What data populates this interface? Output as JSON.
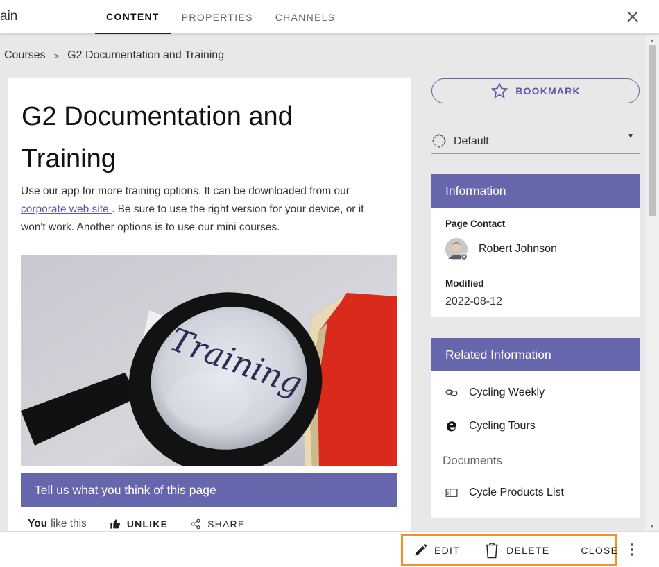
{
  "header": {
    "cut_title": "ain",
    "tabs": [
      {
        "label": "CONTENT",
        "active": true
      },
      {
        "label": "PROPERTIES",
        "active": false
      },
      {
        "label": "CHANNELS",
        "active": false
      }
    ]
  },
  "breadcrumb": {
    "items": [
      "Courses",
      "G2 Documentation and Training"
    ],
    "separator": ">"
  },
  "article": {
    "title": "G2 Documentation and Training",
    "intro_before": "Use our app for more training options. It can be downloaded from our ",
    "link_text": "corporate web site ",
    "intro_after": ". Be sure to use the right version for your device, or it won't work. Another options is to use our mini courses.",
    "hero_image_text": "Training",
    "feedback_label": "Tell us what you think of this page",
    "you_label": "You",
    "like_text": "like this",
    "unlike_label": "UNLIKE",
    "share_label": "SHARE"
  },
  "sidebar": {
    "bookmark_label": "BOOKMARK",
    "select_value": "Default",
    "information": {
      "heading": "Information",
      "contact_label": "Page Contact",
      "contact_name": "Robert Johnson",
      "modified_label": "Modified",
      "modified_value": "2022-08-12"
    },
    "related": {
      "heading": "Related Information",
      "links": [
        {
          "label": "Cycling Weekly",
          "icon": "link-icon"
        },
        {
          "label": "Cycling Tours",
          "icon": "edge-browser-icon"
        }
      ],
      "documents_heading": "Documents",
      "documents": [
        {
          "label": "Cycle Products List",
          "icon": "list-document-icon"
        }
      ]
    }
  },
  "commands": {
    "edit": "EDIT",
    "delete": "DELETE",
    "close": "CLOSE"
  },
  "colors": {
    "accent": "#6566ab",
    "highlight_border": "#f39026"
  }
}
